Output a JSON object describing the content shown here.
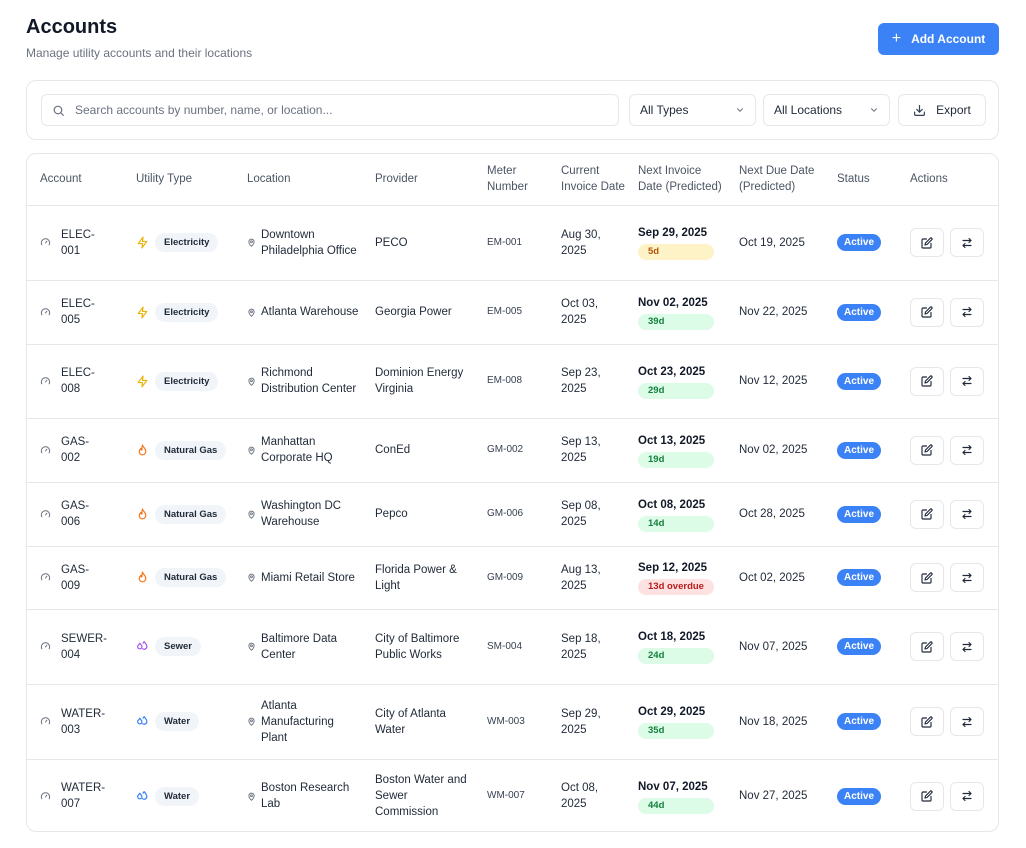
{
  "header": {
    "title": "Accounts",
    "subtitle": "Manage utility accounts and their locations",
    "add_button": "Add Account"
  },
  "toolbar": {
    "search_placeholder": "Search accounts by number, name, or location...",
    "type_filter": "All Types",
    "location_filter": "All Locations",
    "export_label": "Export"
  },
  "table": {
    "columns": {
      "account": "Account",
      "utility_type": "Utility Type",
      "location": "Location",
      "provider": "Provider",
      "meter": "Meter Number",
      "current_invoice": "Current Invoice Date",
      "next_invoice": "Next Invoice Date (Predicted)",
      "next_due": "Next Due Date (Predicted)",
      "status": "Status",
      "actions": "Actions"
    },
    "rows": [
      {
        "account": "ELEC-001",
        "type": "Electricity",
        "type_icon": "lightning-icon",
        "location": "Downtown Philadelphia Office",
        "provider": "PECO",
        "meter": "EM-001",
        "current_invoice": "Aug 30, 2025",
        "next_invoice": "Sep 29, 2025",
        "days": "5d",
        "days_tone": "yellow",
        "next_due": "Oct 19, 2025",
        "status": "Active"
      },
      {
        "account": "ELEC-005",
        "type": "Electricity",
        "type_icon": "lightning-icon",
        "location": "Atlanta Warehouse",
        "provider": "Georgia Power",
        "meter": "EM-005",
        "current_invoice": "Oct 03, 2025",
        "next_invoice": "Nov 02, 2025",
        "days": "39d",
        "days_tone": "green",
        "next_due": "Nov 22, 2025",
        "status": "Active"
      },
      {
        "account": "ELEC-008",
        "type": "Electricity",
        "type_icon": "lightning-icon",
        "location": "Richmond Distribution Center",
        "provider": "Dominion Energy Virginia",
        "meter": "EM-008",
        "current_invoice": "Sep 23, 2025",
        "next_invoice": "Oct 23, 2025",
        "days": "29d",
        "days_tone": "green",
        "next_due": "Nov 12, 2025",
        "status": "Active"
      },
      {
        "account": "GAS-002",
        "type": "Natural Gas",
        "type_icon": "flame-icon",
        "location": "Manhattan Corporate HQ",
        "provider": "ConEd",
        "meter": "GM-002",
        "current_invoice": "Sep 13, 2025",
        "next_invoice": "Oct 13, 2025",
        "days": "19d",
        "days_tone": "green",
        "next_due": "Nov 02, 2025",
        "status": "Active"
      },
      {
        "account": "GAS-006",
        "type": "Natural Gas",
        "type_icon": "flame-icon",
        "location": "Washington DC Warehouse",
        "provider": "Pepco",
        "meter": "GM-006",
        "current_invoice": "Sep 08, 2025",
        "next_invoice": "Oct 08, 2025",
        "days": "14d",
        "days_tone": "green",
        "next_due": "Oct 28, 2025",
        "status": "Active"
      },
      {
        "account": "GAS-009",
        "type": "Natural Gas",
        "type_icon": "flame-icon",
        "location": "Miami Retail Store",
        "provider": "Florida Power & Light",
        "meter": "GM-009",
        "current_invoice": "Aug 13, 2025",
        "next_invoice": "Sep 12, 2025",
        "days": "13d overdue",
        "days_tone": "red",
        "next_due": "Oct 02, 2025",
        "status": "Active"
      },
      {
        "account": "SEWER-004",
        "type": "Sewer",
        "type_icon": "droplets-icon",
        "location": "Baltimore Data Center",
        "provider": "City of Baltimore Public Works",
        "meter": "SM-004",
        "current_invoice": "Sep 18, 2025",
        "next_invoice": "Oct 18, 2025",
        "days": "24d",
        "days_tone": "green",
        "next_due": "Nov 07, 2025",
        "status": "Active"
      },
      {
        "account": "WATER-003",
        "type": "Water",
        "type_icon": "droplets-icon",
        "location": "Atlanta Manufacturing Plant",
        "provider": "City of Atlanta Water",
        "meter": "WM-003",
        "current_invoice": "Sep 29, 2025",
        "next_invoice": "Oct 29, 2025",
        "days": "35d",
        "days_tone": "green",
        "next_due": "Nov 18, 2025",
        "status": "Active"
      },
      {
        "account": "WATER-007",
        "type": "Water",
        "type_icon": "droplets-icon",
        "location": "Boston Research Lab",
        "provider": "Boston Water and Sewer Commission",
        "meter": "WM-007",
        "current_invoice": "Oct 08, 2025",
        "next_invoice": "Nov 07, 2025",
        "days": "44d",
        "days_tone": "green",
        "next_due": "Nov 27, 2025",
        "status": "Active"
      }
    ]
  },
  "colors": {
    "accent": "#3b82f6",
    "electricity_icon": "#eab308",
    "gas_icon": "#f97316",
    "sewer_icon": "#a855f7",
    "water_icon": "#3b82f6"
  }
}
